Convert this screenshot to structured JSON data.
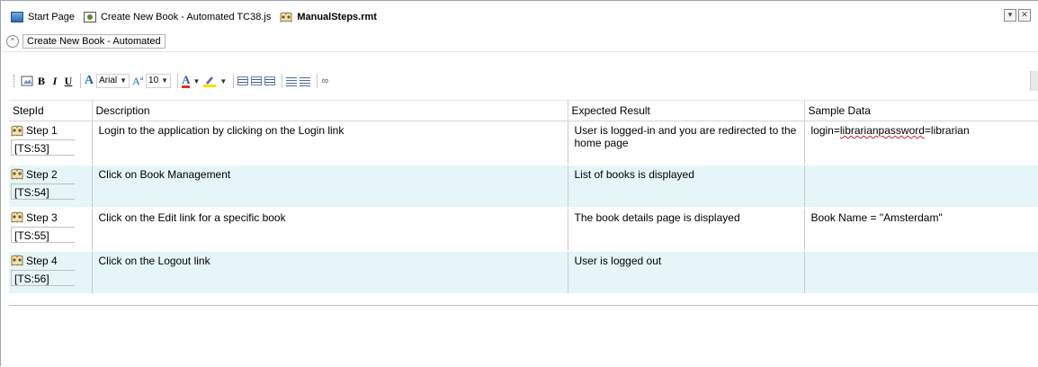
{
  "tabs": [
    {
      "label": "Start Page",
      "icon": "start-page-icon",
      "active": false
    },
    {
      "label": "Create New Book - Automated TC38.js",
      "icon": "script-file-icon",
      "active": false
    },
    {
      "label": "ManualSteps.rmt",
      "icon": "manual-steps-icon",
      "active": true
    }
  ],
  "tab_controls": {
    "dropdown": "▾",
    "close": "✕"
  },
  "breadcrumb": {
    "collapse": "^",
    "title": "Create New Book - Automated"
  },
  "toolbar": {
    "font_name": "Arial",
    "font_size": "10"
  },
  "grid": {
    "columns": [
      "StepId",
      "Description",
      "Expected Result",
      "Sample Data"
    ],
    "rows": [
      {
        "step": "Step 1",
        "ts": "[TS:53]",
        "description": "Login to the application by clicking on the Login link",
        "expected": "User is logged-in and you are redirected to the home page",
        "sample_pre": "login=",
        "sample_flag": "librarianpassword",
        "sample_post": "=librarian"
      },
      {
        "step": "Step 2",
        "ts": "[TS:54]",
        "description": "Click on Book Management",
        "expected": "List of books is displayed",
        "sample_pre": "",
        "sample_flag": "",
        "sample_post": ""
      },
      {
        "step": "Step 3",
        "ts": "[TS:55]",
        "description": "Click on the Edit link for a specific book",
        "expected": "The book details page is displayed",
        "sample_pre": "Book Name = \"Amsterdam\"",
        "sample_flag": "",
        "sample_post": ""
      },
      {
        "step": "Step 4",
        "ts": "[TS:56]",
        "description": "Click on the Logout link",
        "expected": "User is logged out",
        "sample_pre": "",
        "sample_flag": "",
        "sample_post": ""
      }
    ]
  }
}
